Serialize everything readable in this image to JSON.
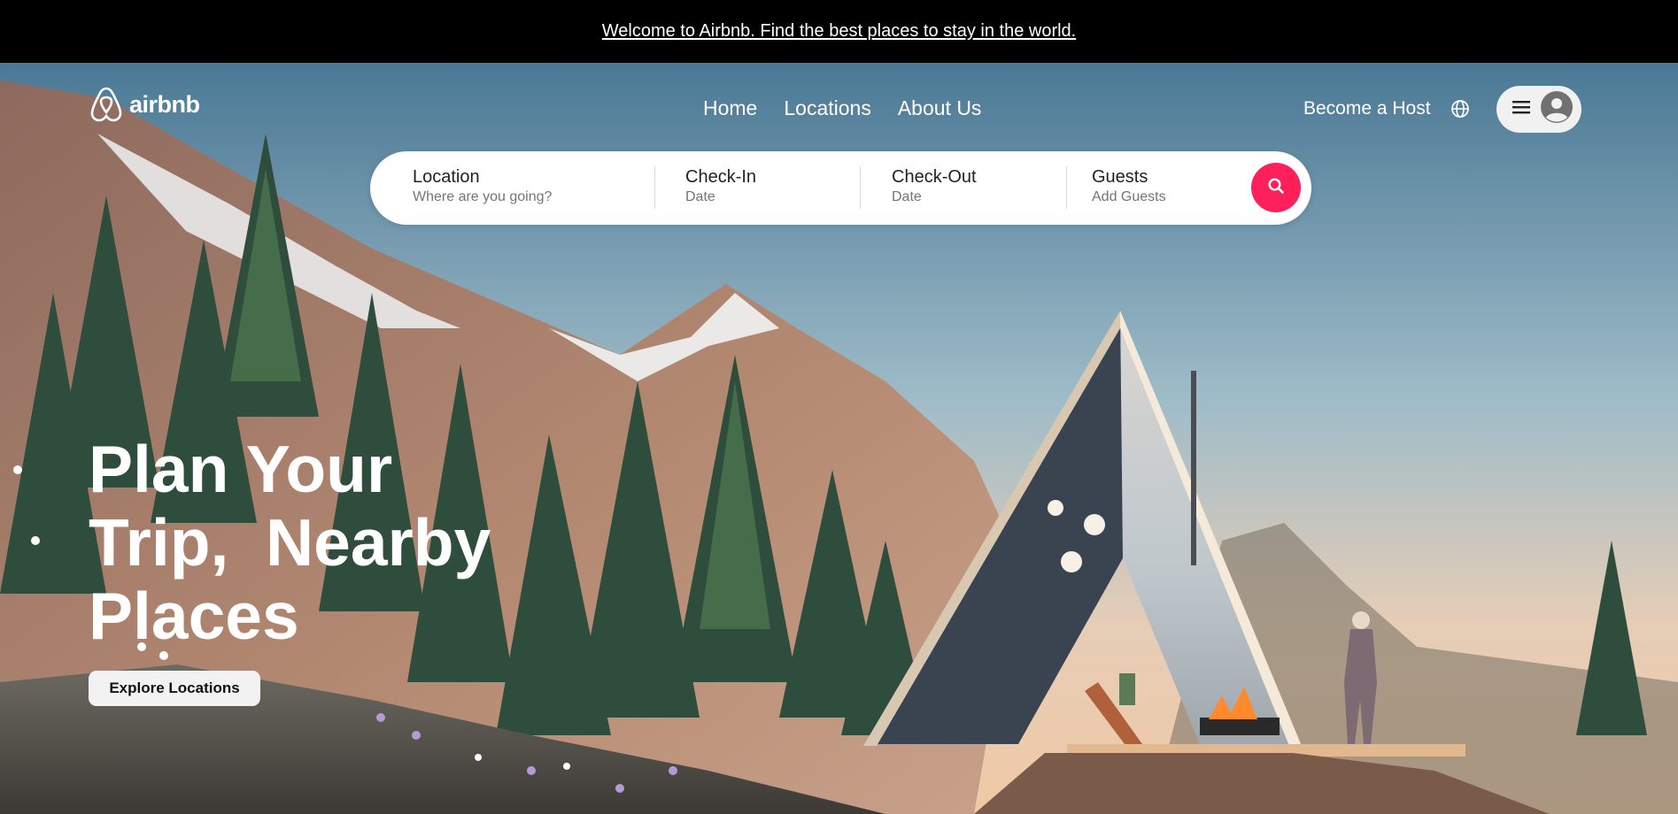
{
  "announcement": {
    "text": "Welcome to Airbnb. Find the best places to stay in the world."
  },
  "brand": {
    "name": "airbnb",
    "accent": "#ff1f5a"
  },
  "nav": {
    "items": [
      {
        "label": "Home"
      },
      {
        "label": "Locations"
      },
      {
        "label": "About Us"
      }
    ]
  },
  "header": {
    "become_host_label": "Become a Host",
    "globe_icon": "globe-icon",
    "menu_icon": "hamburger-icon",
    "avatar_icon": "user-avatar-icon"
  },
  "search": {
    "fields": [
      {
        "title": "Location",
        "placeholder": "Where are you going?"
      },
      {
        "title": "Check-In",
        "placeholder": "Date"
      },
      {
        "title": "Check-Out",
        "placeholder": "Date"
      },
      {
        "title": "Guests",
        "placeholder": "Add Guests"
      }
    ],
    "button_icon": "search-icon"
  },
  "hero": {
    "headline": "Plan Your\nTrip,  Nearby\nPlaces",
    "cta_label": "Explore Locations"
  }
}
